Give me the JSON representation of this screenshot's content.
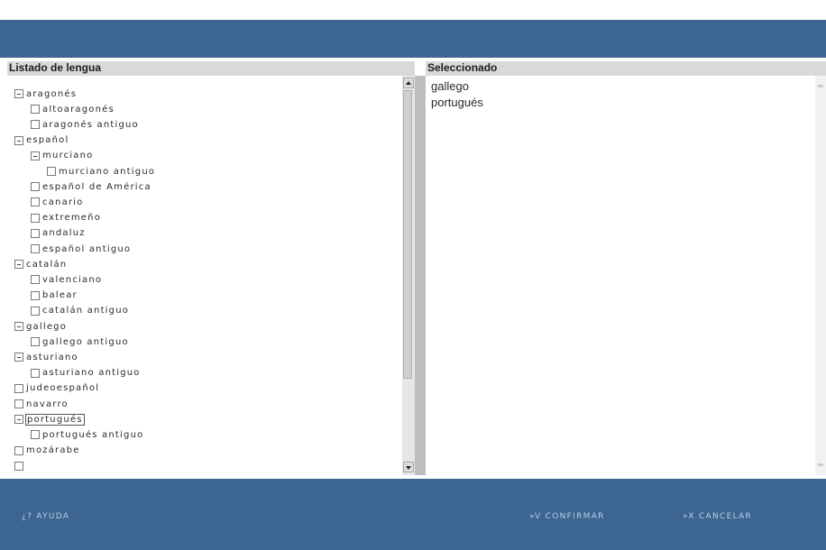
{
  "left_panel": {
    "header": "Listado de lengua",
    "items": [
      {
        "label": "aragonés",
        "depth": 0,
        "expanded": true
      },
      {
        "label": "altoaragonés",
        "depth": 1,
        "expanded": false
      },
      {
        "label": "aragonés antiguo",
        "depth": 1,
        "expanded": false
      },
      {
        "label": "español",
        "depth": 0,
        "expanded": true
      },
      {
        "label": "murciano",
        "depth": 1,
        "expanded": true
      },
      {
        "label": "murciano antiguo",
        "depth": 2,
        "expanded": false
      },
      {
        "label": "español de América",
        "depth": 1,
        "expanded": false
      },
      {
        "label": "canario",
        "depth": 1,
        "expanded": false
      },
      {
        "label": "extremeño",
        "depth": 1,
        "expanded": false
      },
      {
        "label": "andaluz",
        "depth": 1,
        "expanded": false
      },
      {
        "label": "español antiguo",
        "depth": 1,
        "expanded": false
      },
      {
        "label": "catalán",
        "depth": 0,
        "expanded": true
      },
      {
        "label": "valenciano",
        "depth": 1,
        "expanded": false
      },
      {
        "label": "balear",
        "depth": 1,
        "expanded": false
      },
      {
        "label": "catalán antiguo",
        "depth": 1,
        "expanded": false
      },
      {
        "label": "gallego",
        "depth": 0,
        "expanded": true
      },
      {
        "label": "gallego antiguo",
        "depth": 1,
        "expanded": false
      },
      {
        "label": "asturiano",
        "depth": 0,
        "expanded": true
      },
      {
        "label": "asturiano antiguo",
        "depth": 1,
        "expanded": false
      },
      {
        "label": "judeoespañol",
        "depth": 0,
        "expanded": false
      },
      {
        "label": "navarro",
        "depth": 0,
        "expanded": false
      },
      {
        "label": "portugués",
        "depth": 0,
        "expanded": true,
        "focused": true
      },
      {
        "label": "portugués antiguo",
        "depth": 1,
        "expanded": false
      },
      {
        "label": "mozárabe",
        "depth": 0,
        "expanded": false
      }
    ]
  },
  "right_panel": {
    "header": "Seleccionado",
    "items": [
      "gallego",
      "portugués"
    ]
  },
  "footer": {
    "help_label": "¿? AYUDA",
    "confirm_label": "»V CONFIRMAR",
    "cancel_label": "»X CANCELAR"
  },
  "colors": {
    "bar_blue": "#3c6591",
    "header_gray": "#d9d9d9",
    "footer_text": "#bcd0e6"
  },
  "icons": {
    "expanded": "minus-box-icon",
    "collapsed": "empty-box-icon",
    "scroll_up": "scroll-up-arrow-icon",
    "scroll_down": "scroll-down-arrow-icon"
  }
}
